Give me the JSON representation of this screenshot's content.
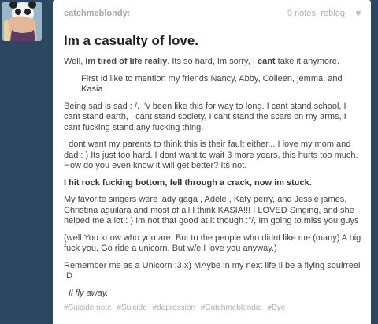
{
  "post": {
    "username": "catchmeblondy:",
    "notes": "9 notes",
    "reblog": "reblog",
    "title": "Im a casualty of love.",
    "paragraphs": {
      "p1_a": "Well, ",
      "p1_b": "Im tired of life really",
      "p1_c": ". Its so hard, Im sorry, I ",
      "p1_d": "cant",
      "p1_e": " take it anymore.",
      "p2": "First Id like to mention my friends Nancy, Abby, Colleen, jemma, and Kasia",
      "p3": "Being sad is sad : /. I'v been like this for way to long. I cant stand school, I cant stand earth, I cant stand society, I cant stand the scars on my arms, I cant fucking stand any fucking thing.",
      "p4": "I dont want my parents to think this is their fault either... I love my mom and dad : ) Its just too hard. I dont want to wait 3 more years, this hurts too much. How do you even know it will get better? Its not.",
      "p5": "I hit rock fucking bottom, fell through a crack, now im stuck.",
      "p6": " My favorite singers were lady gaga , Adele , Katy perry, and  Jessie james, Christina aguilara and most of all I think KASIA!!! I LOVED Singing, and she helped me a lot  : ) Im not that good at it though :\"/, Im going to miss you guys",
      "p7": "(well You know who you are, But to the people who didnt like me (many) A big fuck you, Go ride a unicorn. But w/e I love you anyway.)",
      "p8": "Remember me as a Unicorn :3 x) MAybe in my next life Il be a flying squirreel :D",
      "p9": "Il fly away."
    },
    "tags": [
      "#Suicide note",
      "#Suicide",
      "#depression",
      "#Catchmeblondie",
      "#Bye"
    ]
  }
}
